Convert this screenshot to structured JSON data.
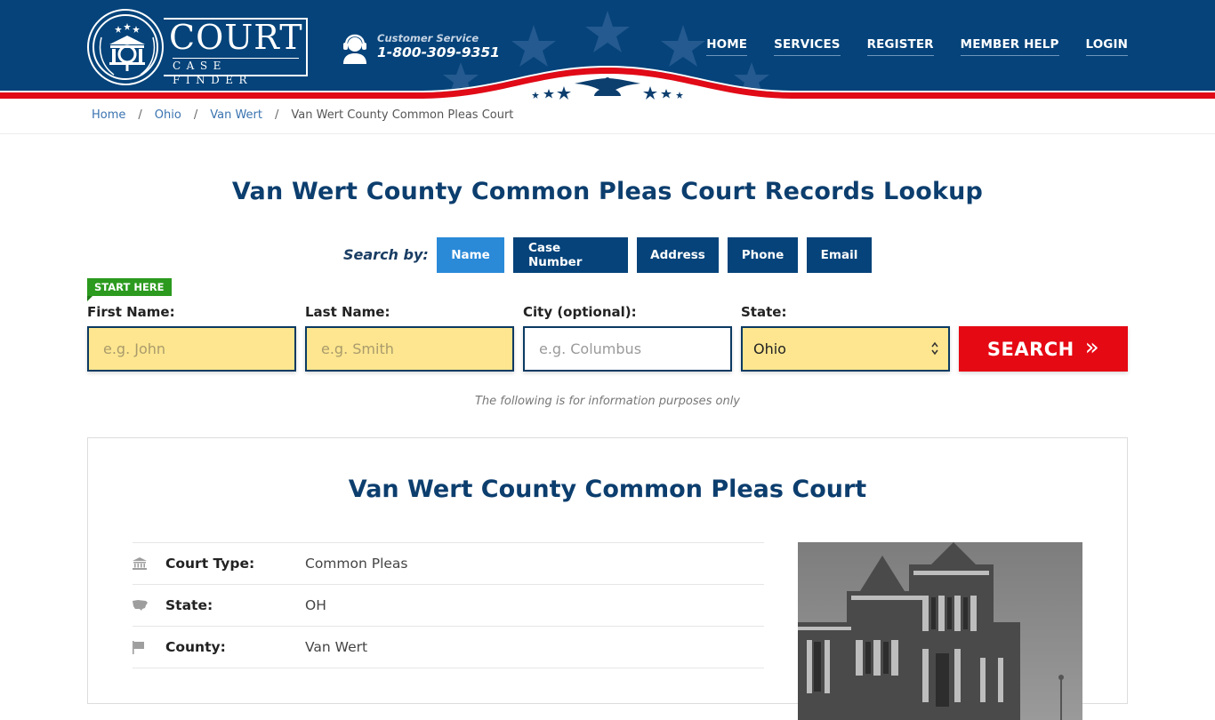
{
  "brand": {
    "name": "COURT",
    "tagline": "CASE FINDER"
  },
  "customer_service": {
    "label": "Customer Service",
    "phone": "1-800-309-9351",
    "icon": "headset-agent-icon"
  },
  "nav": [
    {
      "label": "HOME"
    },
    {
      "label": "SERVICES"
    },
    {
      "label": "REGISTER"
    },
    {
      "label": "MEMBER HELP"
    },
    {
      "label": "LOGIN"
    }
  ],
  "breadcrumb": [
    {
      "label": "Home",
      "link": true
    },
    {
      "label": "Ohio",
      "link": true
    },
    {
      "label": "Van Wert",
      "link": true
    },
    {
      "label": "Van Wert County Common Pleas Court",
      "link": false
    }
  ],
  "page_title": "Van Wert County Common Pleas Court Records Lookup",
  "search": {
    "search_by_label": "Search by:",
    "tabs": [
      {
        "label": "Name",
        "active": true
      },
      {
        "label": "Case Number",
        "active": false
      },
      {
        "label": "Address",
        "active": false
      },
      {
        "label": "Phone",
        "active": false
      },
      {
        "label": "Email",
        "active": false
      }
    ],
    "start_here": "START HERE",
    "fields": {
      "first_name": {
        "label": "First Name:",
        "placeholder": "e.g. John",
        "value": ""
      },
      "last_name": {
        "label": "Last Name:",
        "placeholder": "e.g. Smith",
        "value": ""
      },
      "city": {
        "label": "City (optional):",
        "placeholder": "e.g.  Columbus",
        "value": ""
      },
      "state": {
        "label": "State:",
        "value": "Ohio"
      }
    },
    "button_label": "SEARCH",
    "button_icon": "double-chevron-right-icon",
    "disclaimer": "The following is for information purposes only"
  },
  "court": {
    "title": "Van Wert County Common Pleas Court",
    "details": [
      {
        "icon": "courthouse-icon",
        "label": "Court Type:",
        "value": "Common Pleas"
      },
      {
        "icon": "usa-map-icon",
        "label": "State:",
        "value": "OH"
      },
      {
        "icon": "flag-icon",
        "label": "County:",
        "value": "Van Wert"
      }
    ],
    "photo": "courthouse-photo"
  },
  "colors": {
    "header_blue": "#05437a",
    "accent_red": "#e50914",
    "active_tab": "#2a8ad8",
    "input_yellow": "#fde68f",
    "start_green": "#2b9a1e",
    "title_blue": "#0c3e6e"
  }
}
